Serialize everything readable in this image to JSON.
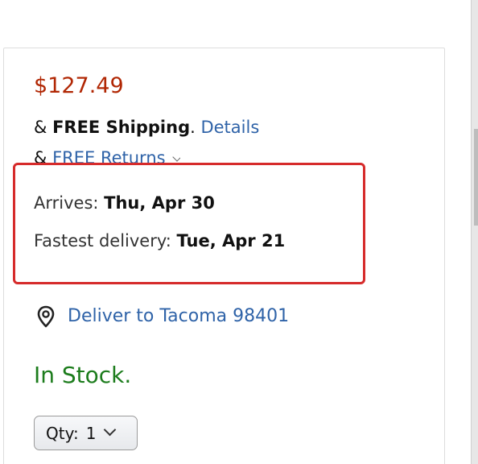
{
  "buybox": {
    "price": "$127.49",
    "shipping": {
      "prefix": "& ",
      "bold": "FREE Shipping",
      "separator": ". ",
      "details_link": "Details"
    },
    "returns": {
      "prefix": "& ",
      "link": "FREE Returns"
    },
    "delivery": {
      "arrives_label": "Arrives: ",
      "arrives_date": "Thu, Apr 30",
      "fastest_label": "Fastest delivery: ",
      "fastest_date": "Tue, Apr 21"
    },
    "deliver_to": "Deliver to Tacoma 98401",
    "stock_status": "In Stock.",
    "quantity": {
      "label": "Qty:",
      "value": "1"
    }
  },
  "colors": {
    "price": "#b12704",
    "link": "#2f63a8",
    "in_stock": "#1c7c1c",
    "highlight_border": "#d62b2b"
  },
  "icons": {
    "location": "location-pin-icon",
    "returns_dropdown": "chevron-down-icon",
    "qty_dropdown": "chevron-down-icon"
  }
}
